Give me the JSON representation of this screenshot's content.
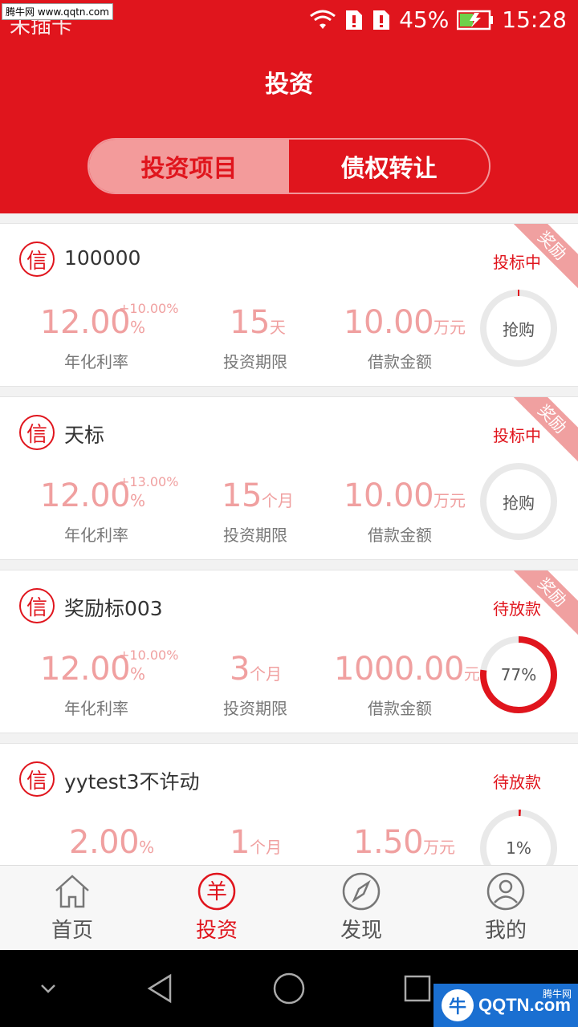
{
  "watermark_top": "腾牛网 www.qqtn.com",
  "status_bar": {
    "carrier": "未插卡",
    "battery": "45%",
    "time": "15:28"
  },
  "header": {
    "title": "投资"
  },
  "segment": {
    "tabs": [
      {
        "label": "投资项目"
      },
      {
        "label": "债权转让"
      }
    ]
  },
  "colors": {
    "brand": "#e0151d",
    "muted_value": "#f0a0a0",
    "ring_bg": "#e9e9e9"
  },
  "labels": {
    "rate": "年化利率",
    "term": "投资期限",
    "amount": "借款金额"
  },
  "cards": [
    {
      "badge": "信",
      "title": "100000",
      "status": "投标中",
      "ribbon": "奖励",
      "rate": "12.00",
      "rate_unit": "%",
      "bonus": "+10.00%",
      "term": "15",
      "term_unit": "天",
      "amount": "10.00",
      "amount_unit": "万元",
      "ring_text": "抢购",
      "progress": 0
    },
    {
      "badge": "信",
      "title": "天标",
      "status": "投标中",
      "ribbon": "奖励",
      "rate": "12.00",
      "rate_unit": "%",
      "bonus": "+13.00%",
      "term": "15",
      "term_unit": "个月",
      "amount": "10.00",
      "amount_unit": "万元",
      "ring_text": "抢购",
      "progress": 0
    },
    {
      "badge": "信",
      "title": "奖励标003",
      "status": "待放款",
      "ribbon": "奖励",
      "rate": "12.00",
      "rate_unit": "%",
      "bonus": "+10.00%",
      "term": "3",
      "term_unit": "个月",
      "amount": "1000.00",
      "amount_unit": "元",
      "ring_text": "77%",
      "progress": 0.77
    },
    {
      "badge": "信",
      "title": "yytest3不许动",
      "status": "待放款",
      "ribbon": "",
      "rate": "2.00",
      "rate_unit": "%",
      "bonus": "",
      "term": "1",
      "term_unit": "个月",
      "amount": "1.50",
      "amount_unit": "万元",
      "ring_text": "1%",
      "progress": 0.01
    }
  ],
  "tabbar": {
    "items": [
      {
        "label": "首页",
        "icon": "home-icon"
      },
      {
        "label": "投资",
        "icon": "yen-circle-icon",
        "active": true
      },
      {
        "label": "发现",
        "icon": "compass-icon"
      },
      {
        "label": "我的",
        "icon": "user-icon"
      }
    ]
  },
  "yen_glyph": "羊",
  "watermark_bottom": {
    "logo": "牛",
    "text": "QQTN.com",
    "sub": "腾牛网"
  }
}
